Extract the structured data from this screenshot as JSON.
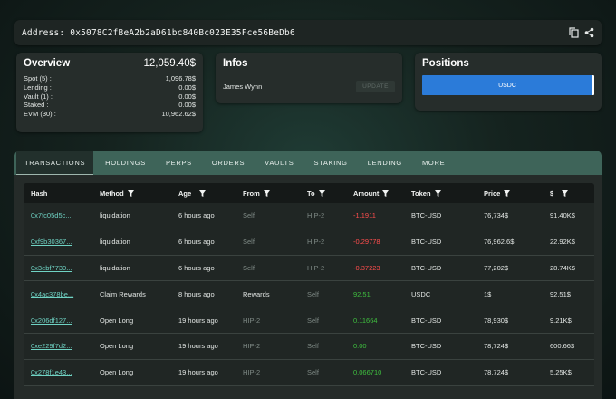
{
  "address": {
    "label": "Address: 0x5078C2fBeA2b2aD61bc840Bc023E35Fce56BeDb6",
    "copy_icon": "copy-icon",
    "share_icon": "share-icon"
  },
  "overview": {
    "title": "Overview",
    "total": "12,059.40$",
    "rows": [
      {
        "label": "Spot (5) :",
        "value": "1,096.78$"
      },
      {
        "label": "Lending :",
        "value": "0.00$"
      },
      {
        "label": "Vault (1) :",
        "value": "0.00$"
      },
      {
        "label": "Staked :",
        "value": "0.00$"
      },
      {
        "label": "EVM (30) :",
        "value": "10,962.62$"
      }
    ]
  },
  "infos": {
    "title": "Infos",
    "name": "James Wynn",
    "update_label": "UPDATE"
  },
  "positions": {
    "title": "Positions",
    "bar_label": "USDC"
  },
  "tabs": [
    "TRANSACTIONS",
    "HOLDINGS",
    "PERPS",
    "ORDERS",
    "VAULTS",
    "STAKING",
    "LENDING",
    "MORE"
  ],
  "table": {
    "headers": [
      "Hash",
      "Method",
      "Age",
      "From",
      "To",
      "Amount",
      "Token",
      "Price",
      "$"
    ],
    "rows": [
      {
        "hash": "0x7fc05d5c...",
        "method": "liquidation",
        "age": "6 hours ago",
        "from": "Self",
        "to": "HIP-2",
        "amount": "-1.1911",
        "amount_sign": "neg",
        "token": "BTC-USD",
        "price": "76,734$",
        "usd": "91.40K$"
      },
      {
        "hash": "0xf9b30367...",
        "method": "liquidation",
        "age": "6 hours ago",
        "from": "Self",
        "to": "HIP-2",
        "amount": "-0.29778",
        "amount_sign": "neg",
        "token": "BTC-USD",
        "price": "76,962.6$",
        "usd": "22.92K$"
      },
      {
        "hash": "0x3ebf7730...",
        "method": "liquidation",
        "age": "6 hours ago",
        "from": "Self",
        "to": "HIP-2",
        "amount": "-0.37223",
        "amount_sign": "neg",
        "token": "BTC-USD",
        "price": "77,202$",
        "usd": "28.74K$"
      },
      {
        "hash": "0x4ac378be...",
        "method": "Claim Rewards",
        "age": "8 hours ago",
        "from": "Rewards",
        "to": "Self",
        "amount": "92.51",
        "amount_sign": "pos",
        "token": "USDC",
        "price": "1$",
        "usd": "92.51$"
      },
      {
        "hash": "0x206df127...",
        "method": "Open Long",
        "age": "19 hours ago",
        "from": "HIP-2",
        "to": "Self",
        "amount": "0.11664",
        "amount_sign": "pos",
        "token": "BTC-USD",
        "price": "78,930$",
        "usd": "9.21K$"
      },
      {
        "hash": "0xe229f7d2...",
        "method": "Open Long",
        "age": "19 hours ago",
        "from": "HIP-2",
        "to": "Self",
        "amount": "0.00",
        "amount_sign": "pos",
        "token": "BTC-USD",
        "price": "78,724$",
        "usd": "600.66$"
      },
      {
        "hash": "0x278f1e43...",
        "method": "Open Long",
        "age": "19 hours ago",
        "from": "HIP-2",
        "to": "Self",
        "amount": "0.066710",
        "amount_sign": "pos",
        "token": "BTC-USD",
        "price": "78,724$",
        "usd": "5.25K$"
      }
    ]
  }
}
